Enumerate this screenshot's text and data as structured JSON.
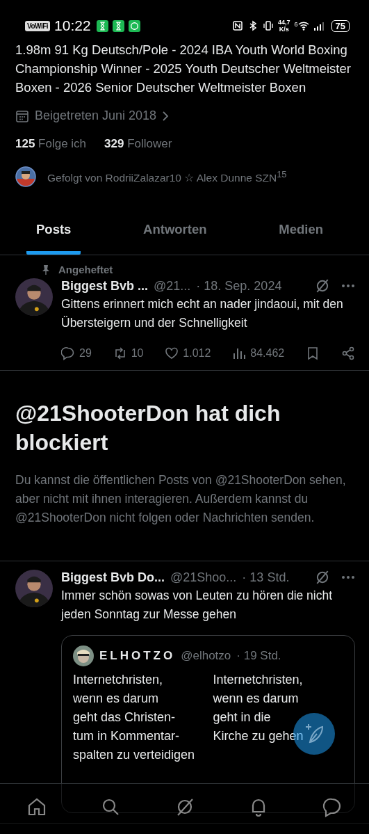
{
  "status_bar": {
    "vowifi": "VoWiFi",
    "time": "10:22",
    "speed_value": "44,7",
    "speed_unit": "K/s",
    "wifi_label": "6",
    "battery": "75"
  },
  "profile": {
    "bio": "1.98m 91 Kg Deutsch/Pole - 2024 IBA Youth World Boxing Championship Winner - 2025 Youth Deutscher Weltmeister Boxen - 2026 Senior Deutscher Weltmeister Boxen",
    "joined": "Beigetreten Juni 2018",
    "following_count": "125",
    "following_label": "Folge ich",
    "followers_count": "329",
    "followers_label": "Follower",
    "followed_by": "Gefolgt von RodriiZalazar10 ☆ Alex Dunne SZN$^{15}$"
  },
  "tabs": [
    {
      "label": "Posts",
      "selected": true
    },
    {
      "label": "Antworten",
      "selected": false
    },
    {
      "label": "Medien",
      "selected": false
    }
  ],
  "feed": [
    {
      "kind": "post",
      "pinned_label": "Angeheftet",
      "name": "Biggest Bvb ...",
      "handle": "@21...",
      "time": "· 18. Sep. 2024",
      "text": "Gittens erinnert mich echt an nader jindaoui, mit den Übersteigern und der Schnelligkeit",
      "replies": "29",
      "reposts": "10",
      "likes": "1.012",
      "views": "84.462"
    },
    {
      "kind": "blocked",
      "title": "@21ShooterDon hat dich blockiert",
      "text": "Du kannst die öffentlichen Posts von @21ShooterDon sehen, aber nicht mit ihnen interagieren. Außerdem kannst du @21ShooterDon nicht folgen oder Nachrichten senden."
    },
    {
      "kind": "post",
      "name": "Biggest Bvb Do...",
      "handle": "@21Shoo...",
      "time": "· 13 Std.",
      "text": "Immer schön sowas von Leuten zu hören die nicht jeden Sonntag zur Messe gehen",
      "quote": {
        "name": "ELHOTZO",
        "handle": "@elhotzo",
        "time": "· 19 Std.",
        "columns": [
          [
            "Internetchristen,",
            "wenn es darum",
            "geht das Christen-",
            "tum in Kommentar-",
            "spalten zu verteidigen"
          ],
          [
            "Internetchristen,",
            "wenn es darum",
            "geht in die",
            "Kirche zu gehen"
          ]
        ]
      }
    }
  ]
}
